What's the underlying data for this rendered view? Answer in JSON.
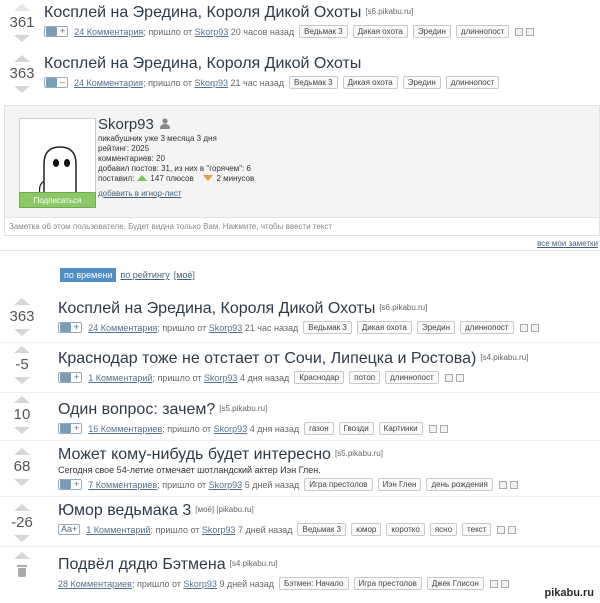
{
  "top_posts": [
    {
      "score": "361",
      "title": "Косплей на Эредина, Короля Дикой Охоты",
      "domain": "[s6.pikabu.ru]",
      "comments": "24 Комментария",
      "from_prefix": "; пришло от",
      "author": "Skorp93",
      "time": "20 часов назад",
      "tags": [
        "Ведьмак 3",
        "Дикая охота",
        "Эредин",
        "длиннопост"
      ],
      "ctrl_sign": "+"
    },
    {
      "score": "363",
      "title": "Косплей на Эредина, Короля Дикой Охоты",
      "domain": "[s6.pikabu.ru]",
      "comments": "24 Комментария",
      "from_prefix": "; пришло от",
      "author": "Skorp93",
      "time": "21 час назад",
      "tags": [
        "Ведьмак 3",
        "Дикая охота",
        "Эредин",
        "длиннопост"
      ],
      "ctrl_sign": "–"
    }
  ],
  "profile": {
    "name": "Skorp93",
    "since": "пикабушник уже 3 месяца 3 дня",
    "rating": "рейтинг: 2025",
    "comments": "комментариев: 20",
    "posts": "добавил постов: 31, из них в \"горячем\": 6",
    "votes_prefix": "поставил:",
    "pluses": "147 плюсов",
    "minuses": "2 минусов",
    "ignore": "добавить в игнор-лист",
    "subscribe": "Подписаться",
    "note": "Заметка об этом пользователе. Будет видна только Вам. Нажмите, чтобы ввести текст",
    "all_notes": "все мои заметки"
  },
  "sort": {
    "by_time": "по времени",
    "by_rating": "по рейтингу",
    "mine": "[моё]"
  },
  "posts": [
    {
      "score": "363",
      "title": "Косплей на Эредина, Короля Дикой Охоты",
      "domain": "[s6.pikabu.ru]",
      "subtitle": "",
      "comments": "24 Комментария",
      "from_prefix": "; пришло от",
      "author": "Skorp93",
      "time": "21 час назад",
      "tags": [
        "Ведьмак 3",
        "Дикая охота",
        "Эредин",
        "длиннопост"
      ],
      "ctrl_sign": "+"
    },
    {
      "score": "-5",
      "title": "Краснодар тоже не отстает от Сочи, Липецка и Ростова)",
      "domain": "[s4.pikabu.ru]",
      "subtitle": "",
      "comments": "1 Комментарий",
      "from_prefix": "; пришло от",
      "author": "Skorp93",
      "time": "4 дня назад",
      "tags": [
        "Краснодар",
        "потоп",
        "длиннопост"
      ],
      "ctrl_sign": "+"
    },
    {
      "score": "10",
      "title": "Один вопрос: зачем?",
      "domain": "[s5.pikabu.ru]",
      "subtitle": "",
      "comments": "16 Комментариев",
      "from_prefix": "; пришло от",
      "author": "Skorp93",
      "time": "4 дня назад",
      "tags": [
        "газон",
        "Гвозди",
        "Картинки"
      ],
      "ctrl_sign": "+"
    },
    {
      "score": "68",
      "title": "Может кому-нибудь будет интересно",
      "domain": "[s5.pikabu.ru]",
      "subtitle": "Сегодня свое 54-летие отмечает шотландский актер Иэн Глен.",
      "comments": "7 Комментариев",
      "from_prefix": "; пришло от",
      "author": "Skorp93",
      "time": "5 дней назад",
      "tags": [
        "Игра престолов",
        "Иэн Глен",
        "день рождения"
      ],
      "ctrl_sign": "+"
    },
    {
      "score": "-26",
      "title": "Юмор ведьмака 3",
      "domain": "[моё] [pikabu.ru]",
      "subtitle": "",
      "comments": "1 Комментарий",
      "from_prefix": "; пришло от",
      "author": "Skorp93",
      "time": "7 дней назад",
      "tags": [
        "Ведьмак 3",
        "юмор",
        "коротко",
        "ясно",
        "текст"
      ],
      "ctrl_sign": "Aa+"
    },
    {
      "score": "",
      "title": "Подвёл дядю Бэтмена",
      "domain": "[s4.pikabu.ru]",
      "subtitle": "",
      "comments": "28 Комментариев",
      "from_prefix": "; пришло от",
      "author": "Skorp93",
      "time": "9 дней назад",
      "tags": [
        "Бэтмен: Начало",
        "Игра престолов",
        "Джек Глисон"
      ],
      "ctrl_sign": ""
    }
  ],
  "watermark": "pikabu.ru"
}
